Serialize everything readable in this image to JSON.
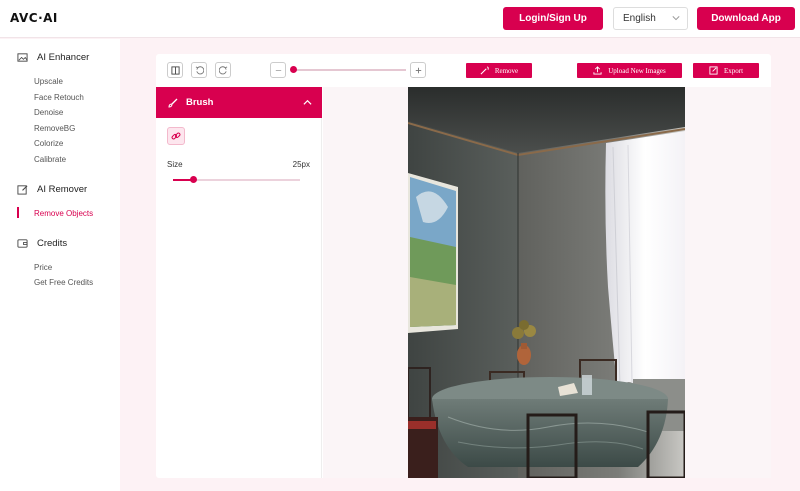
{
  "header": {
    "logo": "AVC·AI",
    "login_label": "Login/Sign Up",
    "language": "English",
    "download_label": "Download App"
  },
  "sidebar": {
    "sections": [
      {
        "title": "AI Enhancer",
        "icon": "image-icon",
        "items": [
          "Upscale",
          "Face Retouch",
          "Denoise",
          "RemoveBG",
          "Colorize",
          "Calibrate"
        ]
      },
      {
        "title": "AI Remover",
        "icon": "edit-icon",
        "items": [
          "Remove Objects"
        ]
      },
      {
        "title": "Credits",
        "icon": "wallet-icon",
        "items": [
          "Price",
          "Get Free Credits"
        ]
      }
    ],
    "active_item": "Remove Objects"
  },
  "toolbar": {
    "remove_label": "Remove",
    "upload_label": "Upload New Images",
    "export_label": "Export",
    "zoom_level": 0
  },
  "brush": {
    "title": "Brush",
    "size_label": "Size",
    "size_value": "25px",
    "size_fraction": 0.16
  },
  "colors": {
    "accent": "#d8004f",
    "page_bg": "#fdf2f5"
  }
}
